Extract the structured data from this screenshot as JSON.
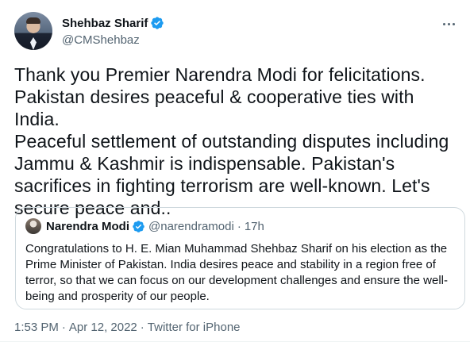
{
  "tweet": {
    "author_name": "Shehbaz Sharif",
    "author_handle": "@CMShehbaz",
    "text": "Thank you Premier Narendra Modi for felicitations.\nPakistan desires peaceful & cooperative ties with India.\nPeaceful settlement of outstanding disputes including\nJammu & Kashmir is indispensable. Pakistan's\nsacrifices in fighting terrorism are well-known. Let's\nsecure peace and..",
    "time": "1:53 PM",
    "separator": "·",
    "date": "Apr 12, 2022",
    "source": "Twitter for iPhone"
  },
  "quoted": {
    "author_name": "Narendra Modi",
    "author_handle": "@narendramodi",
    "separator": "·",
    "age": "17h",
    "text": "Congratulations to H. E. Mian Muhammad Shehbaz Sharif on his election as the Prime Minister of Pakistan. India desires peace and stability in a region free of terror, so that we can focus on our development challenges and ensure the well-being and prosperity of our people."
  },
  "icons": {
    "verified": "verified-badge-icon",
    "more": "more-options-icon"
  },
  "colors": {
    "verified_blue": "#1d9bf0",
    "secondary_text": "#536471",
    "primary_text": "#0f1419",
    "border": "#cfd9de"
  }
}
